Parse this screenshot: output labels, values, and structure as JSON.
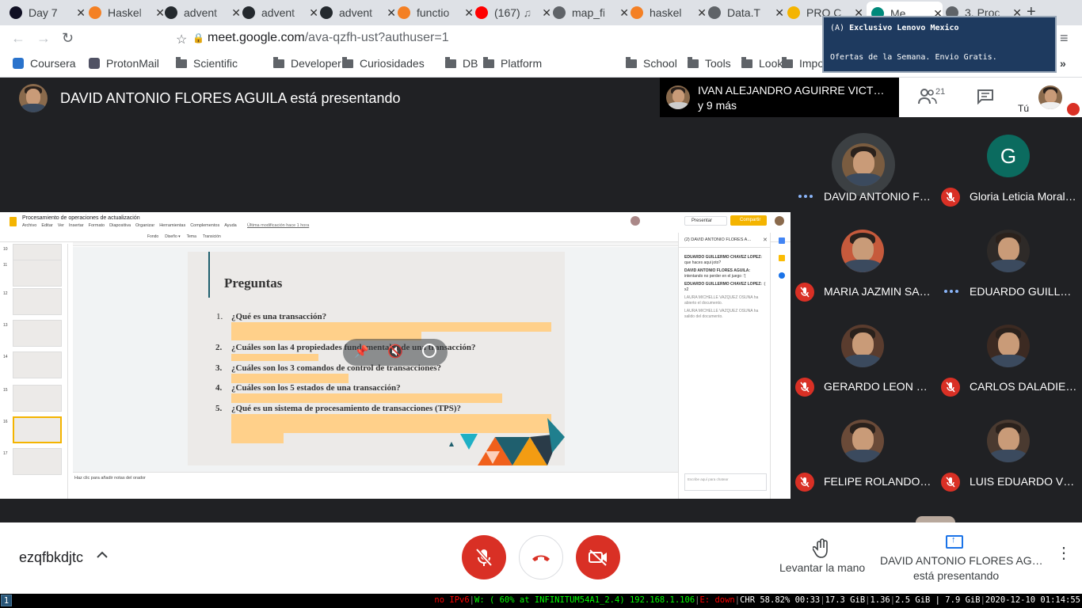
{
  "browser": {
    "tabs": [
      {
        "title": "Day 7",
        "icon": "aoc-star-icon"
      },
      {
        "title": "Haskel",
        "icon": "so-icon"
      },
      {
        "title": "advent",
        "icon": "github-icon"
      },
      {
        "title": "advent",
        "icon": "github-icon"
      },
      {
        "title": "advent",
        "icon": "github-icon"
      },
      {
        "title": "functio",
        "icon": "so-icon"
      },
      {
        "title": "(167) ♫",
        "icon": "youtube-icon"
      },
      {
        "title": "map_fi",
        "icon": "globe-icon"
      },
      {
        "title": "haskel",
        "icon": "so-icon"
      },
      {
        "title": "Data.T",
        "icon": "globe-icon"
      },
      {
        "title": "PRO C",
        "icon": "slides-icon"
      },
      {
        "title": "Me",
        "icon": "meet-icon"
      },
      {
        "title": "3. Proc",
        "icon": "globe-icon"
      }
    ],
    "new_tab": "+",
    "url_host": "meet.google.com",
    "url_path": "/ava-qzfh-ust?authuser=1",
    "bookmarks": [
      "Coursera",
      "ProtonMail",
      "Scientific",
      "Developer",
      "Curiosidades",
      "DB",
      "Platform",
      "School",
      "Tools",
      "Look",
      "Imported"
    ],
    "more": "»"
  },
  "popup": {
    "line1_prefix": "(A) ",
    "line1_bold": "Exclusivo Lenovo Mexico",
    "line2": "Ofertas de la Semana. Envio Gratis."
  },
  "meet": {
    "presenter_banner": "DAVID ANTONIO FLORES AGUILA está presentando",
    "people_preview": {
      "name": "IVAN ALEJANDRO AGUIRRE VICT…",
      "more": "y 9 más"
    },
    "participant_count": "21",
    "self_label": "Tú",
    "tiles": [
      {
        "name": "DAVID ANTONIO FL…",
        "status": "speaking",
        "avatar": "photo"
      },
      {
        "name": "Gloria Leticia Moral…",
        "status": "muted",
        "avatar": "letter",
        "letter": "G"
      },
      {
        "name": "MARIA JAZMIN SA…",
        "status": "muted",
        "avatar": "photo"
      },
      {
        "name": "EDUARDO GUILLER…",
        "status": "speaking",
        "avatar": "photo"
      },
      {
        "name": "GERARDO LEON SA…",
        "status": "muted",
        "avatar": "photo"
      },
      {
        "name": "CARLOS DALADIER …",
        "status": "muted",
        "avatar": "photo"
      },
      {
        "name": "FELIPE ROLANDO V…",
        "status": "muted",
        "avatar": "photo"
      },
      {
        "name": "LUIS EDUARDO VIL…",
        "status": "muted",
        "avatar": "photo"
      }
    ],
    "meeting_code": "ezqfbkdjtc",
    "raise_hand": "Levantar la mano",
    "presenting_line1": "DAVID ANTONIO FLORES AG…",
    "presenting_line2": "está presentando"
  },
  "slides_app": {
    "doc_title": "Procesamiento de operaciones de actualización",
    "menus": [
      "Archivo",
      "Editar",
      "Ver",
      "Insertar",
      "Formato",
      "Diapositiva",
      "Organizar",
      "Herramientas",
      "Complementos",
      "Ayuda"
    ],
    "last_edit": "Última modificación hace 1 hora",
    "toolbar_words": [
      "Fondo",
      "Diseño ▾",
      "Tema",
      "Transición"
    ],
    "present_button": "Presentar",
    "share_button": "Compartir",
    "slide_title": "Preguntas",
    "questions": [
      {
        "n": "1.",
        "text": "¿Qué es una transacción?"
      },
      {
        "n": "2.",
        "text": "¿Cuáles son las 4 propiedades fundamentales de una transacción?"
      },
      {
        "n": "3.",
        "text": "¿Cuáles son los 3 comandos de control de transacciones?"
      },
      {
        "n": "4.",
        "text": "¿Cuáles son los 5 estados de una transacción?"
      },
      {
        "n": "5.",
        "text": "¿Qué es un sistema de procesamiento de transacciones (TPS)?"
      }
    ],
    "speaker_notes": "Haz clic para añadir notas del orador",
    "thumb_numbers": [
      "10",
      "11",
      "12",
      "13",
      "14",
      "15",
      "16",
      "17"
    ],
    "chat": {
      "header": "(2) DAVID ANTONIO FLORES A…",
      "messages": [
        {
          "author": "EDUARDO GUILLERMO CHAVEZ LOPEZ:",
          "text": "que haces aqui joto?"
        },
        {
          "author": "DAVID ANTONIO FLORES AGUILA:",
          "text": "intentando no perder en el juego :'("
        },
        {
          "author": "EDUARDO GUILLERMO CHAVEZ LOPEZ:",
          "text": ":( x2"
        },
        {
          "author": "",
          "text": "LAURA MICHELLE VAZQUEZ OSUNA ha abierto el documento."
        },
        {
          "author": "",
          "text": "LAURA MICHELLE VAZQUEZ OSUNA ha salido del documento."
        }
      ],
      "input_placeholder": "Escribe aquí para chatear"
    }
  },
  "statusbar": {
    "workspace": "1",
    "ipv6": "no IPv6",
    "wifi": "W: ( 60% at INFINITUM54A1_2.4) 192.168.1.106",
    "eth": "E: down",
    "battery": "CHR 58.82% 00:33",
    "disk": "17.3 GiB",
    "load": "1.36",
    "mem": "2.5 GiB | 7.9 GiB",
    "datetime": "2020-12-10 01:14:55"
  },
  "colors": {
    "accent_red": "#d93025",
    "meet_bg": "#202124",
    "wifi_green": "#00ff00",
    "alert_red": "#ff0000",
    "highlight_orange": "#ffd08a"
  }
}
